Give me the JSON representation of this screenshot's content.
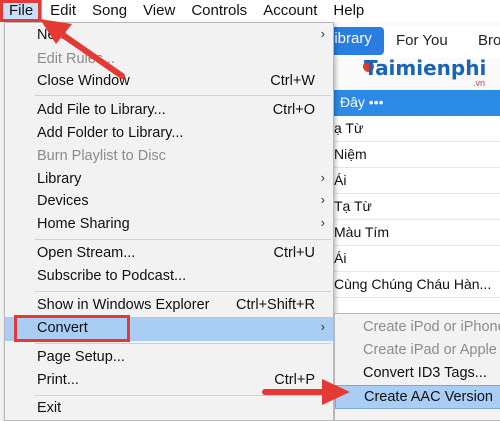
{
  "menubar": {
    "items": [
      "File",
      "Edit",
      "Song",
      "View",
      "Controls",
      "Account",
      "Help"
    ]
  },
  "background": {
    "tabs": {
      "library": "Library",
      "for_you": "For You",
      "browse": "Bro"
    },
    "logo": {
      "name": "Taimienphi",
      "suffix": ".vn"
    },
    "list_header": "Đây •••",
    "rows": [
      "ạ Từ",
      "Niệm",
      "Ái",
      "Tạ Từ",
      "Màu Tím",
      "Ái",
      "Cùng Chúng Cháu Hàn...",
      ""
    ]
  },
  "file_menu": {
    "items": [
      {
        "label": "New",
        "shortcut": "",
        "submenu": true,
        "disabled": false
      },
      {
        "label": "Edit Rules...",
        "shortcut": "",
        "submenu": false,
        "disabled": true
      },
      {
        "label": "Close Window",
        "shortcut": "Ctrl+W",
        "submenu": false,
        "disabled": false
      },
      {
        "label": "Add File to Library...",
        "shortcut": "Ctrl+O",
        "submenu": false,
        "disabled": false
      },
      {
        "label": "Add Folder to Library...",
        "shortcut": "",
        "submenu": false,
        "disabled": false
      },
      {
        "label": "Burn Playlist to Disc",
        "shortcut": "",
        "submenu": false,
        "disabled": true
      },
      {
        "label": "Library",
        "shortcut": "",
        "submenu": true,
        "disabled": false
      },
      {
        "label": "Devices",
        "shortcut": "",
        "submenu": true,
        "disabled": false
      },
      {
        "label": "Home Sharing",
        "shortcut": "",
        "submenu": true,
        "disabled": false
      },
      {
        "label": "Open Stream...",
        "shortcut": "Ctrl+U",
        "submenu": false,
        "disabled": false
      },
      {
        "label": "Subscribe to Podcast...",
        "shortcut": "",
        "submenu": false,
        "disabled": false
      },
      {
        "label": "Show in Windows Explorer",
        "shortcut": "Ctrl+Shift+R",
        "submenu": false,
        "disabled": false
      },
      {
        "label": "Convert",
        "shortcut": "",
        "submenu": true,
        "disabled": false
      },
      {
        "label": "Page Setup...",
        "shortcut": "",
        "submenu": false,
        "disabled": false
      },
      {
        "label": "Print...",
        "shortcut": "Ctrl+P",
        "submenu": false,
        "disabled": false
      },
      {
        "label": "Exit",
        "shortcut": "",
        "submenu": false,
        "disabled": false
      }
    ]
  },
  "convert_submenu": {
    "items": [
      {
        "label": "Create iPod or iPhone",
        "disabled": true
      },
      {
        "label": "Create iPad or Apple T",
        "disabled": true
      },
      {
        "label": "Convert ID3 Tags...",
        "disabled": false
      },
      {
        "label": "Create AAC Version",
        "disabled": false
      }
    ]
  },
  "colors": {
    "highlight": "#a9cdf3",
    "annotation_red": "#e53935",
    "accent_blue": "#2a7de1"
  },
  "icons": {
    "submenu": "chevron-right-icon",
    "annotation": "red-arrow-icon"
  }
}
